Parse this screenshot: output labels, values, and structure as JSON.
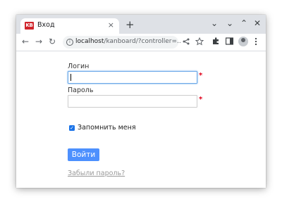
{
  "browser": {
    "tab": {
      "favicon_text": "KB",
      "title": "Вход",
      "close_glyph": "×"
    },
    "new_tab_glyph": "+",
    "window_controls": {
      "tab_search_glyph": "⌄",
      "minimize_glyph": "⌄",
      "maximize_glyph": "⌃",
      "close_glyph": "✕"
    },
    "nav": {
      "back_glyph": "←",
      "forward_glyph": "→",
      "reload_glyph": "↻"
    },
    "address": {
      "host": "localhost",
      "path": "/kanboard/?controller=..."
    },
    "toolbar_icons": [
      "share-icon",
      "star-icon",
      "extensions-icon",
      "side-panel-icon",
      "profile-icon",
      "menu-icon"
    ]
  },
  "login_form": {
    "username_label": "Логин",
    "username_value": "",
    "password_label": "Пароль",
    "password_value": "",
    "required_marker": "*",
    "remember_me_label": "Запомнить меня",
    "remember_me_checked": true,
    "submit_label": "Войти",
    "forgot_password_link": "Забыли пароль?"
  },
  "colors": {
    "accent_button": "#4d90fe",
    "focus_border": "#6aa8e8",
    "required_marker": "#e0001a",
    "favicon_bg": "#d0242b"
  }
}
